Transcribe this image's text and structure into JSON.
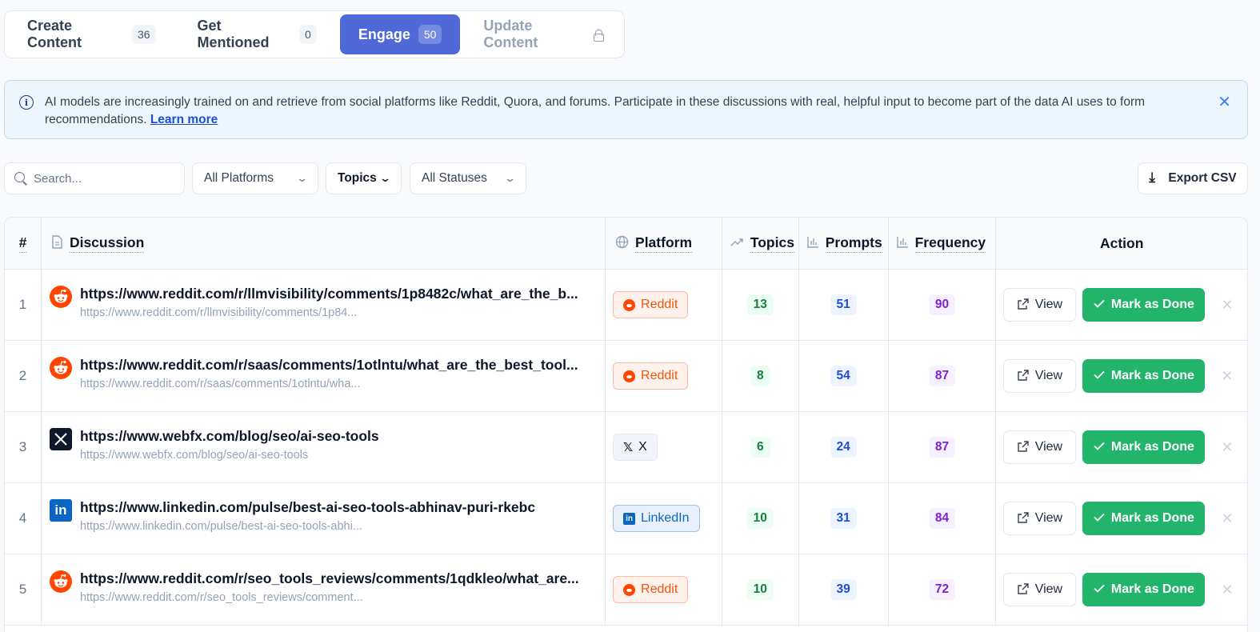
{
  "tabs": [
    {
      "label": "Create Content",
      "count": "36"
    },
    {
      "label": "Get Mentioned",
      "count": "0"
    },
    {
      "label": "Engage",
      "count": "50"
    },
    {
      "label": "Update Content"
    }
  ],
  "banner": {
    "text": "AI models are increasingly trained on and retrieve from social platforms like Reddit, Quora, and forums. Participate in these discussions with real, helpful input to become part of the data AI uses to form recommendations.",
    "link": "Learn more",
    "close": "✕"
  },
  "filters": {
    "search_placeholder": "Search...",
    "platform": "All Platforms",
    "topics": "Topics",
    "status": "All Statuses",
    "export": "Export CSV"
  },
  "table": {
    "headers": {
      "num": "#",
      "discussion": "Discussion",
      "platform": "Platform",
      "topics": "Topics",
      "prompts": "Prompts",
      "frequency": "Frequency",
      "action": "Action"
    },
    "view_label": "View",
    "done_label": "Mark as Done",
    "dismiss": "✕",
    "rows": [
      {
        "num": "1",
        "title": "https://www.reddit.com/r/llmvisibility/comments/1p8482c/what_are_the_b...",
        "sub": "https://www.reddit.com/r/llmvisibility/comments/1p84...",
        "platform": "Reddit",
        "icon": "reddit-icon",
        "topics": "13",
        "prompts": "51",
        "frequency": "90"
      },
      {
        "num": "2",
        "title": "https://www.reddit.com/r/saas/comments/1otlntu/what_are_the_best_tool...",
        "sub": "https://www.reddit.com/r/saas/comments/1otlntu/wha...",
        "platform": "Reddit",
        "icon": "reddit-icon",
        "topics": "8",
        "prompts": "54",
        "frequency": "87"
      },
      {
        "num": "3",
        "title": "https://www.webfx.com/blog/seo/ai-seo-tools",
        "sub": "https://www.webfx.com/blog/seo/ai-seo-tools",
        "platform": "X",
        "icon": "x-icon",
        "topics": "6",
        "prompts": "24",
        "frequency": "87"
      },
      {
        "num": "4",
        "title": "https://www.linkedin.com/pulse/best-ai-seo-tools-abhinav-puri-rkebc",
        "sub": "https://www.linkedin.com/pulse/best-ai-seo-tools-abhi...",
        "platform": "LinkedIn",
        "icon": "linkedin-icon",
        "topics": "10",
        "prompts": "31",
        "frequency": "84"
      },
      {
        "num": "5",
        "title": "https://www.reddit.com/r/seo_tools_reviews/comments/1qdkleo/what_are...",
        "sub": "https://www.reddit.com/r/seo_tools_reviews/comment...",
        "platform": "Reddit",
        "icon": "reddit-icon",
        "topics": "10",
        "prompts": "39",
        "frequency": "72"
      }
    ]
  },
  "colors": {
    "accent": "#4f6ad8",
    "done": "#22b46b",
    "reddit": "#ff4500",
    "linkedin": "#0a66c2"
  }
}
